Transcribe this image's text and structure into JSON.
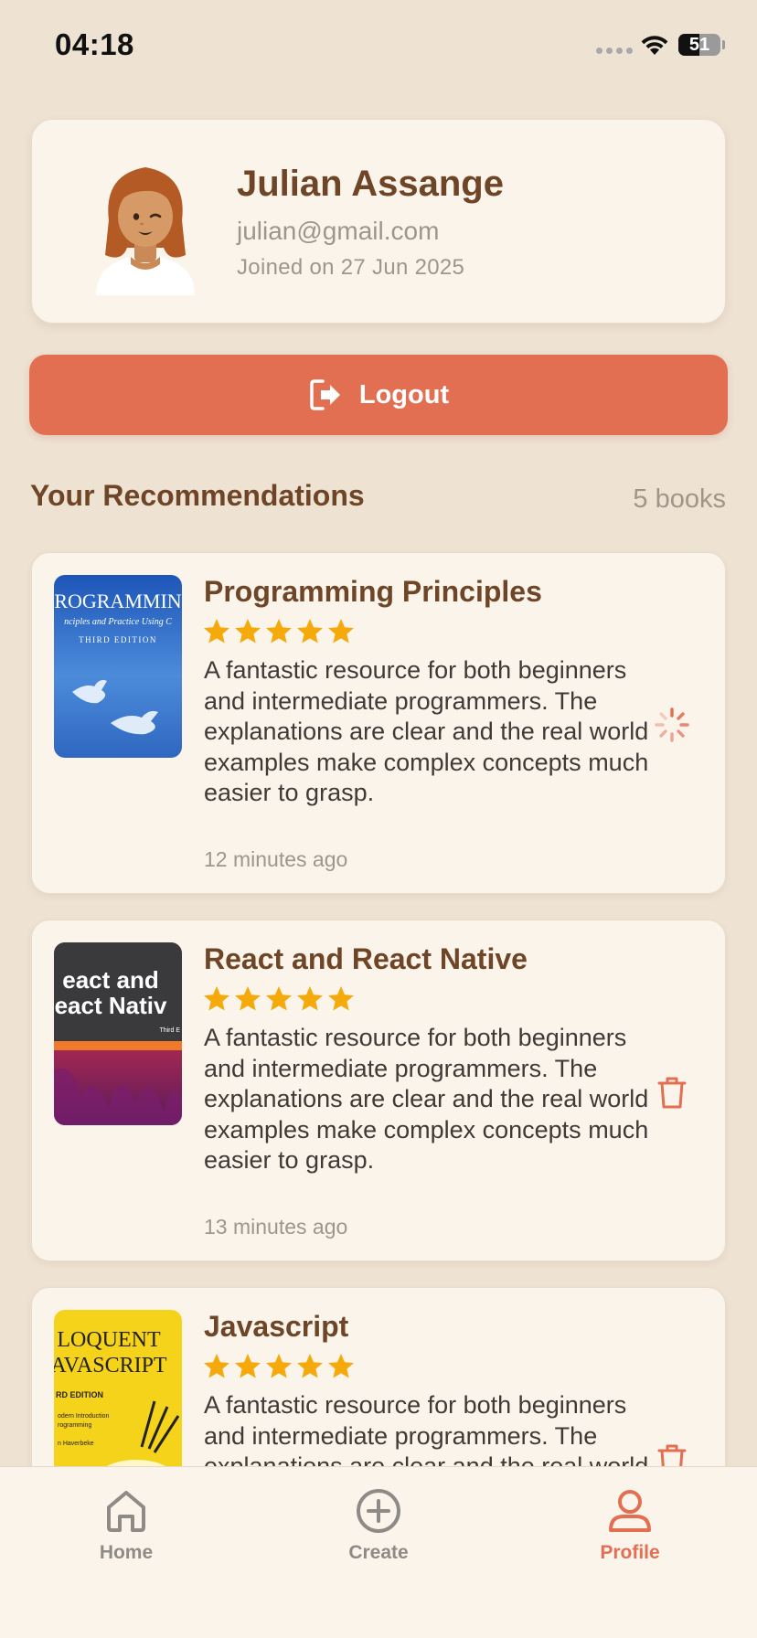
{
  "status_bar": {
    "time": "04:18",
    "battery": "51",
    "battery_level": 0.51,
    "icons": [
      "cellular-signal-icon",
      "wifi-icon",
      "battery-icon"
    ]
  },
  "profile": {
    "name": "Julian Assange",
    "email": "julian@gmail.com",
    "joined": "Joined on 27 Jun 2025",
    "avatar_icon": "avatar-illustration"
  },
  "logout": {
    "label": "Logout",
    "icon": "logout-icon",
    "color": "#E36F53"
  },
  "recommendations_section": {
    "title": "Your Recommendations",
    "count": "5 books"
  },
  "recommendations": [
    {
      "title": "Programming Principles",
      "rating": 5,
      "text": "A fantastic resource for both beginners and intermediate programmers. The explanations are clear and the real world examples make complex concepts much easier to grasp.",
      "time": "12 minutes ago",
      "action": "loading-spinner-icon",
      "cover": {
        "line1": "ROGRAMMIN",
        "line2": "nciples and Practice Using C",
        "line3": "THIRD EDITION"
      }
    },
    {
      "title": "React and React Native",
      "rating": 5,
      "text": "A fantastic resource for both beginners and intermediate programmers. The explanations are clear and the real world examples make complex concepts much easier to grasp.",
      "time": "13 minutes ago",
      "action": "trash-icon",
      "cover": {
        "line1": "eact and",
        "line2": "eact Nativ",
        "line3": "Third E"
      }
    },
    {
      "title": "Javascript",
      "rating": 5,
      "text": "A fantastic resource for both beginners and intermediate programmers. The explanations are clear and the real world examples make complex concepts much easier to grasp.",
      "time": "",
      "action": "trash-icon",
      "cover": {
        "line1": "LOQUENT",
        "line2": "AVASCRIPT",
        "line3": "RD EDITION",
        "line4": "odern Introduction",
        "line5": "rogramming",
        "line6": "n Haverbeke"
      }
    }
  ],
  "tabs": [
    {
      "label": "Home",
      "icon": "home-icon",
      "active": false
    },
    {
      "label": "Create",
      "icon": "plus-circle-icon",
      "active": false
    },
    {
      "label": "Profile",
      "icon": "profile-icon",
      "active": true
    }
  ],
  "colors": {
    "background": "#EEE2D3",
    "card": "#FAF4EB",
    "brown_text": "#6E4526",
    "accent": "#E36F53",
    "star": "#F5A90A",
    "muted": "#A0958A"
  }
}
